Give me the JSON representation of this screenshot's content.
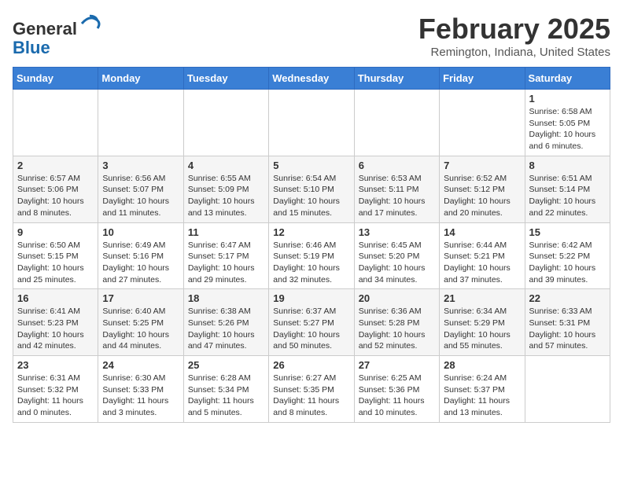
{
  "logo": {
    "general": "General",
    "blue": "Blue"
  },
  "title": "February 2025",
  "location": "Remington, Indiana, United States",
  "days_of_week": [
    "Sunday",
    "Monday",
    "Tuesday",
    "Wednesday",
    "Thursday",
    "Friday",
    "Saturday"
  ],
  "weeks": [
    [
      {
        "day": "",
        "info": ""
      },
      {
        "day": "",
        "info": ""
      },
      {
        "day": "",
        "info": ""
      },
      {
        "day": "",
        "info": ""
      },
      {
        "day": "",
        "info": ""
      },
      {
        "day": "",
        "info": ""
      },
      {
        "day": "1",
        "info": "Sunrise: 6:58 AM\nSunset: 5:05 PM\nDaylight: 10 hours\nand 6 minutes."
      }
    ],
    [
      {
        "day": "2",
        "info": "Sunrise: 6:57 AM\nSunset: 5:06 PM\nDaylight: 10 hours\nand 8 minutes."
      },
      {
        "day": "3",
        "info": "Sunrise: 6:56 AM\nSunset: 5:07 PM\nDaylight: 10 hours\nand 11 minutes."
      },
      {
        "day": "4",
        "info": "Sunrise: 6:55 AM\nSunset: 5:09 PM\nDaylight: 10 hours\nand 13 minutes."
      },
      {
        "day": "5",
        "info": "Sunrise: 6:54 AM\nSunset: 5:10 PM\nDaylight: 10 hours\nand 15 minutes."
      },
      {
        "day": "6",
        "info": "Sunrise: 6:53 AM\nSunset: 5:11 PM\nDaylight: 10 hours\nand 17 minutes."
      },
      {
        "day": "7",
        "info": "Sunrise: 6:52 AM\nSunset: 5:12 PM\nDaylight: 10 hours\nand 20 minutes."
      },
      {
        "day": "8",
        "info": "Sunrise: 6:51 AM\nSunset: 5:14 PM\nDaylight: 10 hours\nand 22 minutes."
      }
    ],
    [
      {
        "day": "9",
        "info": "Sunrise: 6:50 AM\nSunset: 5:15 PM\nDaylight: 10 hours\nand 25 minutes."
      },
      {
        "day": "10",
        "info": "Sunrise: 6:49 AM\nSunset: 5:16 PM\nDaylight: 10 hours\nand 27 minutes."
      },
      {
        "day": "11",
        "info": "Sunrise: 6:47 AM\nSunset: 5:17 PM\nDaylight: 10 hours\nand 29 minutes."
      },
      {
        "day": "12",
        "info": "Sunrise: 6:46 AM\nSunset: 5:19 PM\nDaylight: 10 hours\nand 32 minutes."
      },
      {
        "day": "13",
        "info": "Sunrise: 6:45 AM\nSunset: 5:20 PM\nDaylight: 10 hours\nand 34 minutes."
      },
      {
        "day": "14",
        "info": "Sunrise: 6:44 AM\nSunset: 5:21 PM\nDaylight: 10 hours\nand 37 minutes."
      },
      {
        "day": "15",
        "info": "Sunrise: 6:42 AM\nSunset: 5:22 PM\nDaylight: 10 hours\nand 39 minutes."
      }
    ],
    [
      {
        "day": "16",
        "info": "Sunrise: 6:41 AM\nSunset: 5:23 PM\nDaylight: 10 hours\nand 42 minutes."
      },
      {
        "day": "17",
        "info": "Sunrise: 6:40 AM\nSunset: 5:25 PM\nDaylight: 10 hours\nand 44 minutes."
      },
      {
        "day": "18",
        "info": "Sunrise: 6:38 AM\nSunset: 5:26 PM\nDaylight: 10 hours\nand 47 minutes."
      },
      {
        "day": "19",
        "info": "Sunrise: 6:37 AM\nSunset: 5:27 PM\nDaylight: 10 hours\nand 50 minutes."
      },
      {
        "day": "20",
        "info": "Sunrise: 6:36 AM\nSunset: 5:28 PM\nDaylight: 10 hours\nand 52 minutes."
      },
      {
        "day": "21",
        "info": "Sunrise: 6:34 AM\nSunset: 5:29 PM\nDaylight: 10 hours\nand 55 minutes."
      },
      {
        "day": "22",
        "info": "Sunrise: 6:33 AM\nSunset: 5:31 PM\nDaylight: 10 hours\nand 57 minutes."
      }
    ],
    [
      {
        "day": "23",
        "info": "Sunrise: 6:31 AM\nSunset: 5:32 PM\nDaylight: 11 hours\nand 0 minutes."
      },
      {
        "day": "24",
        "info": "Sunrise: 6:30 AM\nSunset: 5:33 PM\nDaylight: 11 hours\nand 3 minutes."
      },
      {
        "day": "25",
        "info": "Sunrise: 6:28 AM\nSunset: 5:34 PM\nDaylight: 11 hours\nand 5 minutes."
      },
      {
        "day": "26",
        "info": "Sunrise: 6:27 AM\nSunset: 5:35 PM\nDaylight: 11 hours\nand 8 minutes."
      },
      {
        "day": "27",
        "info": "Sunrise: 6:25 AM\nSunset: 5:36 PM\nDaylight: 11 hours\nand 10 minutes."
      },
      {
        "day": "28",
        "info": "Sunrise: 6:24 AM\nSunset: 5:37 PM\nDaylight: 11 hours\nand 13 minutes."
      },
      {
        "day": "",
        "info": ""
      }
    ]
  ]
}
